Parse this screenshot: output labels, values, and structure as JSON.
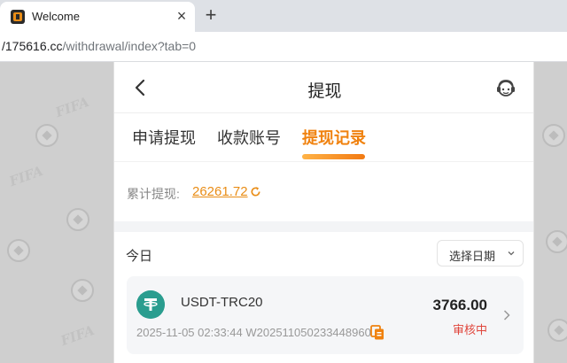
{
  "browser": {
    "tab_title": "Welcome",
    "url_host": "/175616.cc",
    "url_path": "/withdrawal/index?tab=0"
  },
  "header": {
    "title": "提现",
    "back_icon": "chevron-left-icon",
    "service_icon": "customer-service-icon"
  },
  "tabs": [
    {
      "label": "申请提现",
      "active": false
    },
    {
      "label": "收款账号",
      "active": false
    },
    {
      "label": "提现记录",
      "active": true
    }
  ],
  "summary": {
    "label": "累计提现:",
    "value": "26261.72"
  },
  "records": {
    "day_label": "今日",
    "date_picker_label": "选择日期",
    "items": [
      {
        "coin": "USDT-TRC20",
        "amount": "3766.00",
        "status": "审核中",
        "meta": "2025-11-05 02:33:44 W202511050233448960"
      }
    ]
  },
  "colors": {
    "accent": "#f0820f",
    "status_pending": "#e0463c",
    "coin": "#2a9d8f"
  }
}
